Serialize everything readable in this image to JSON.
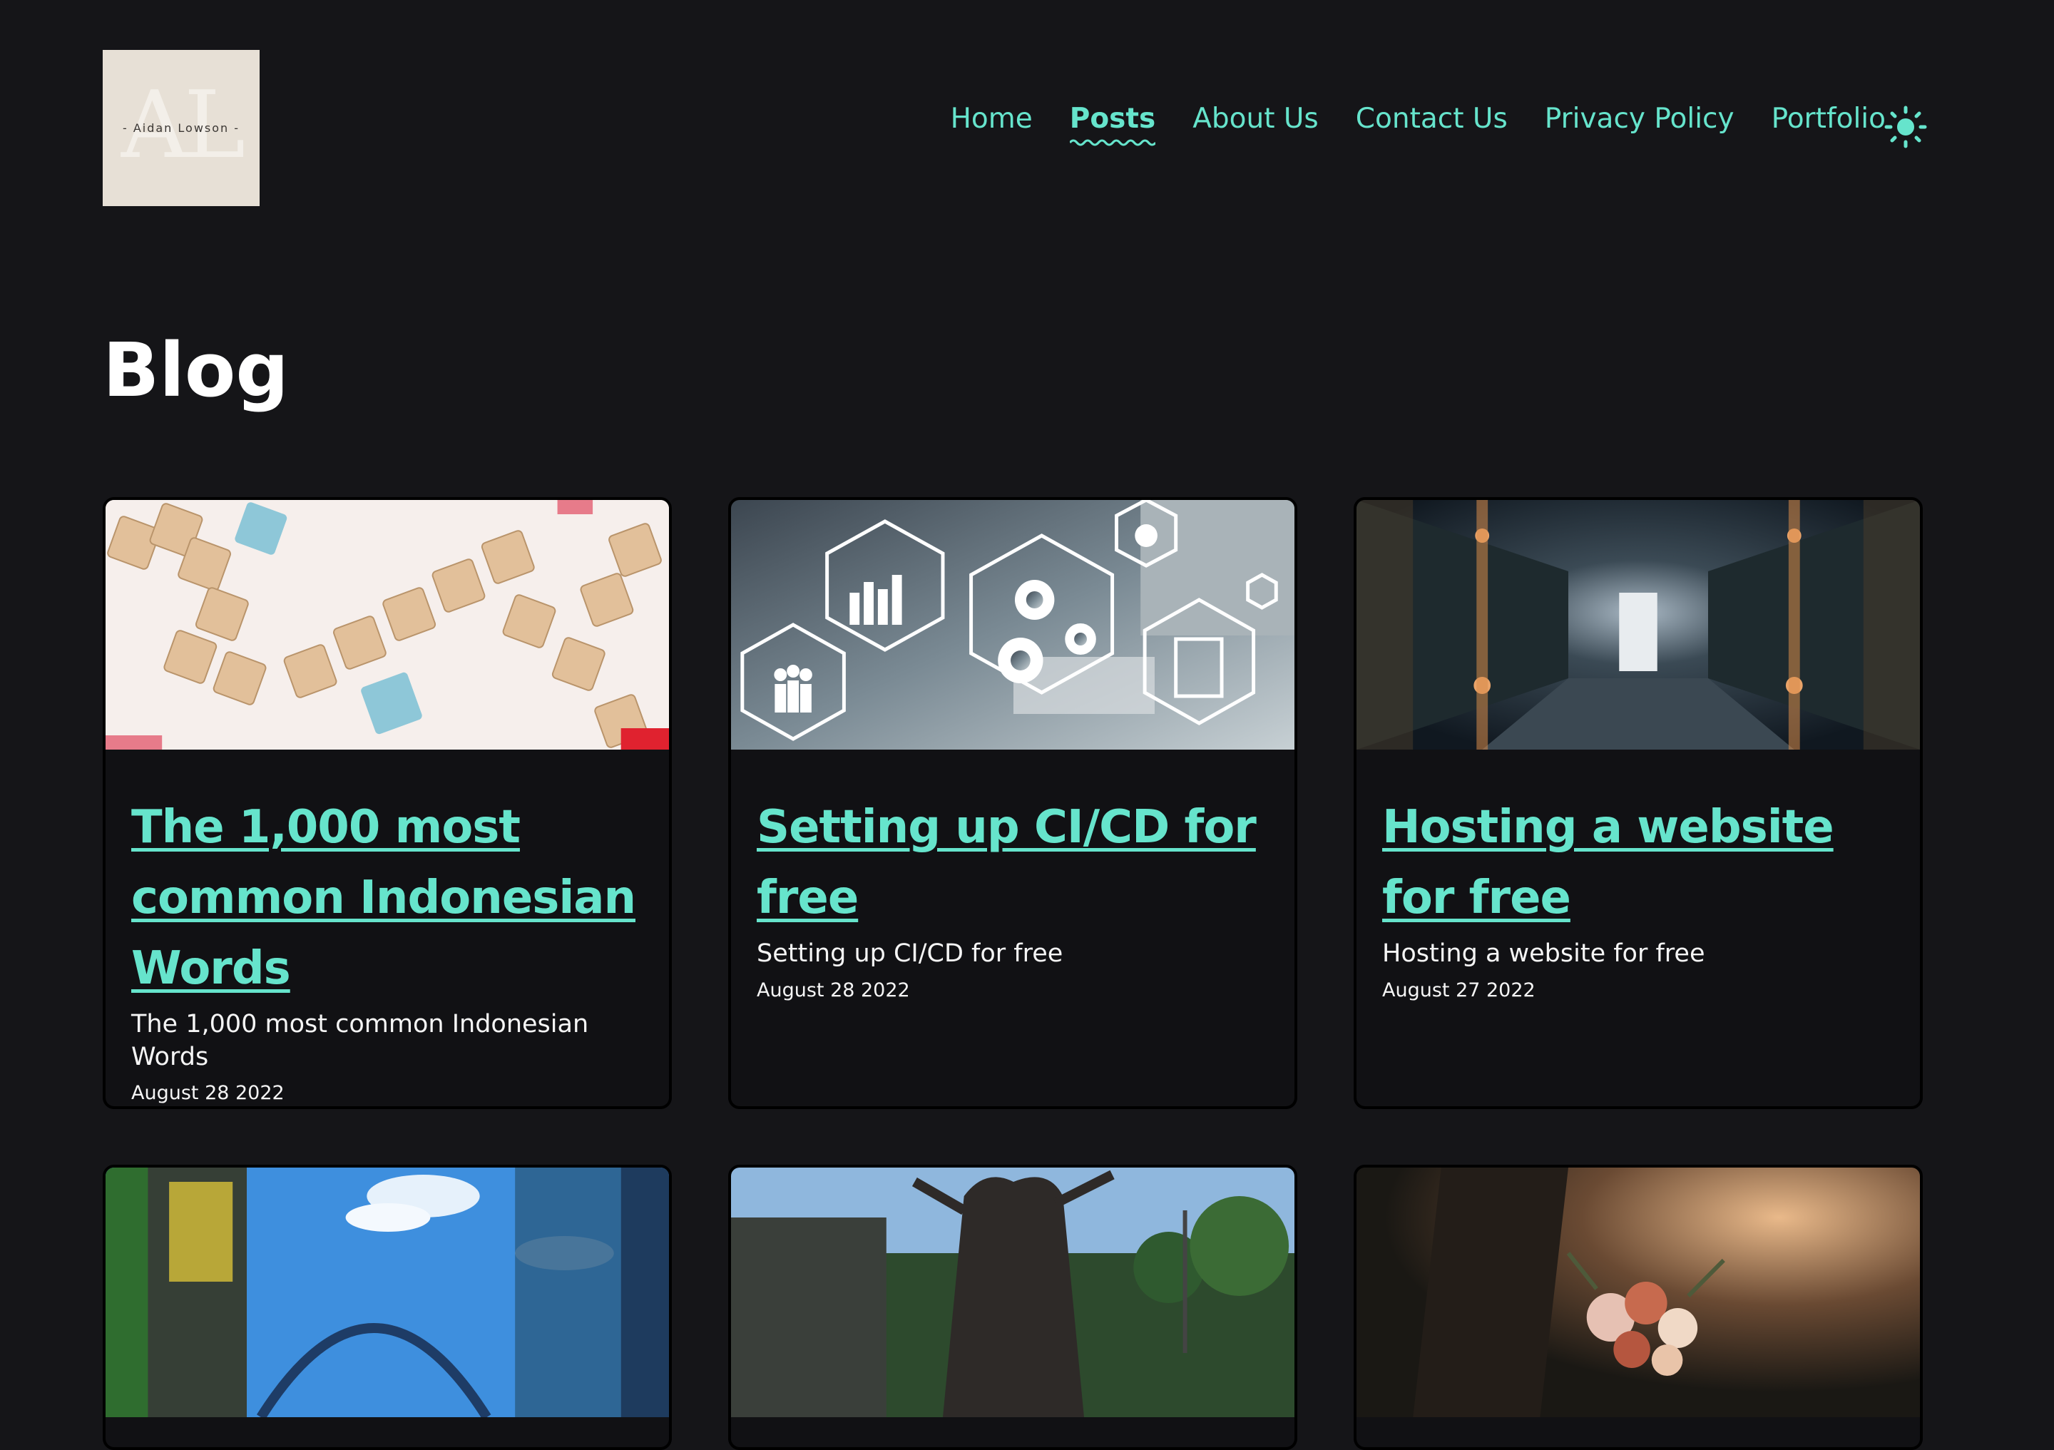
{
  "logo": {
    "monogram": "AL",
    "name": "- Aidan Lowson -"
  },
  "nav": {
    "items": [
      {
        "label": "Home",
        "active": false
      },
      {
        "label": "Posts",
        "active": true
      },
      {
        "label": "About Us",
        "active": false
      },
      {
        "label": "Contact Us",
        "active": false
      },
      {
        "label": "Privacy Policy",
        "active": false
      },
      {
        "label": "Portfolio",
        "active": false
      }
    ],
    "theme_toggle_icon": "sun-icon"
  },
  "page": {
    "title": "Blog"
  },
  "posts": [
    {
      "title": "The 1,000 most common Indonesian Words",
      "description": "The 1,000 most common Indonesian Words",
      "date": "August 28 2022",
      "image": "scrabble-tiles-learn-image"
    },
    {
      "title": "Setting up CI/CD for free",
      "description": "Setting up CI/CD for free",
      "date": "August 28 2022",
      "image": "business-process-icons-image"
    },
    {
      "title": "Hosting a website for free",
      "description": "Hosting a website for free",
      "date": "August 27 2022",
      "image": "server-corridor-image"
    },
    {
      "title": "",
      "description": "",
      "date": "",
      "image": "roller-coaster-image"
    },
    {
      "title": "",
      "description": "",
      "date": "",
      "image": "theme-park-tree-ride-image"
    },
    {
      "title": "",
      "description": "",
      "date": "",
      "image": "bouquet-image"
    }
  ],
  "colors": {
    "background": "#151518",
    "accent": "#66e4cc",
    "card_background": "#111114",
    "text": "#ffffff"
  }
}
